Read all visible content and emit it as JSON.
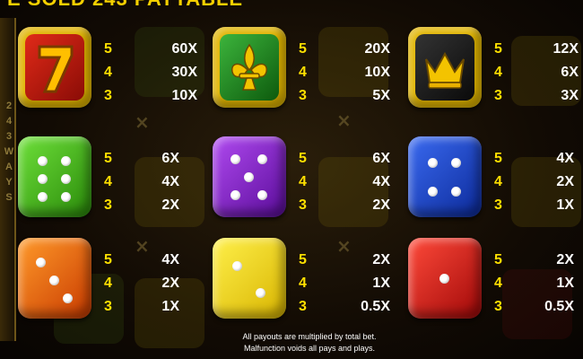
{
  "header": {
    "title": "E SOLD 243  PAYTABLE"
  },
  "side_strip": {
    "letters": [
      "2",
      "4",
      "3",
      "W",
      "A",
      "Y",
      "S"
    ]
  },
  "symbols": [
    {
      "name": "seven",
      "icon": "lucky-seven-icon",
      "color": "#c8180c",
      "counts": [
        "5",
        "4",
        "3"
      ],
      "payouts": [
        "60X",
        "30X",
        "10X"
      ]
    },
    {
      "name": "fleur",
      "icon": "fleur-de-lis-icon",
      "color": "#1f8d1f",
      "counts": [
        "5",
        "4",
        "3"
      ],
      "payouts": [
        "20X",
        "10X",
        "5X"
      ]
    },
    {
      "name": "crown",
      "icon": "crown-icon",
      "color": "#151515",
      "counts": [
        "5",
        "4",
        "3"
      ],
      "payouts": [
        "12X",
        "6X",
        "3X"
      ]
    },
    {
      "name": "green-die",
      "icon": "green-die-six-icon",
      "color": "#3cb014",
      "counts": [
        "5",
        "4",
        "3"
      ],
      "payouts": [
        "6X",
        "4X",
        "2X"
      ]
    },
    {
      "name": "purple-die",
      "icon": "purple-die-five-icon",
      "color": "#8a1fd0",
      "counts": [
        "5",
        "4",
        "3"
      ],
      "payouts": [
        "6X",
        "4X",
        "2X"
      ]
    },
    {
      "name": "blue-die",
      "icon": "blue-die-four-icon",
      "color": "#1846d8",
      "counts": [
        "5",
        "4",
        "3"
      ],
      "payouts": [
        "4X",
        "2X",
        "1X"
      ]
    },
    {
      "name": "orange-die",
      "icon": "orange-die-three-icon",
      "color": "#ef5a08",
      "counts": [
        "5",
        "4",
        "3"
      ],
      "payouts": [
        "4X",
        "2X",
        "1X"
      ]
    },
    {
      "name": "yellow-die",
      "icon": "yellow-die-two-icon",
      "color": "#f0dc00",
      "counts": [
        "5",
        "4",
        "3"
      ],
      "payouts": [
        "2X",
        "1X",
        "0.5X"
      ]
    },
    {
      "name": "red-die",
      "icon": "red-die-one-icon",
      "color": "#d01414",
      "counts": [
        "5",
        "4",
        "3"
      ],
      "payouts": [
        "2X",
        "1X",
        "0.5X"
      ]
    }
  ],
  "footer": {
    "line1": "All payouts are multiplied by total bet.",
    "line2": "Malfunction voids all pays and plays."
  }
}
